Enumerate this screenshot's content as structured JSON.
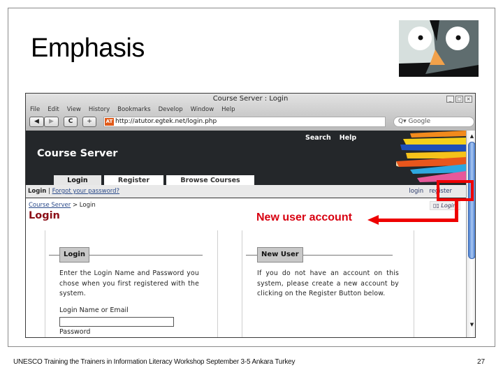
{
  "slide": {
    "title": "Emphasis",
    "footer": "UNESCO Training the Trainers in Information Literacy Workshop September 3-5 Ankara Turkey",
    "page_number": "27",
    "logo_icon": "owl-face-logo"
  },
  "browser": {
    "window_title": "Course Server : Login",
    "window_buttons": {
      "minimize": "_",
      "maximize": "□",
      "close": "×"
    },
    "menu": [
      "File",
      "Edit",
      "View",
      "History",
      "Bookmarks",
      "Develop",
      "Window",
      "Help"
    ],
    "nav": {
      "back": "◀",
      "forward": "▶",
      "reload": "C",
      "new_tab": "+"
    },
    "url": "http://atutor.egtek.net/login.php",
    "favicon_text": "AT",
    "search_placeholder": "Google",
    "search_icon": "Q▾"
  },
  "site": {
    "name": "Course Server",
    "header_links": [
      "Search",
      "Help"
    ],
    "tabs": [
      {
        "label": "Login",
        "active": true
      },
      {
        "label": "Register",
        "active": false
      },
      {
        "label": "Browse Courses",
        "active": false
      }
    ],
    "subnav": {
      "current": "Login",
      "separator": "|",
      "link": "Forgot your password?"
    },
    "subnav_right": {
      "login": "login",
      "register": "register"
    },
    "breadcrumb": {
      "root": "Course Server",
      "separator": ">",
      "current": "Login"
    },
    "page_heading": "Login",
    "small_login_button": "Login",
    "login_box": {
      "label": "Login",
      "text": "Enter the Login Name and Password you chose when you first registered with the system.",
      "name_label": "Login Name or Email",
      "name_value": "",
      "password_label": "Password"
    },
    "new_user_box": {
      "label": "New User",
      "text": "If you do not have an account on this system, please create a new account by clicking on the Register Button below."
    }
  },
  "annotation": {
    "text": "New user account",
    "color": "#ee0000"
  }
}
